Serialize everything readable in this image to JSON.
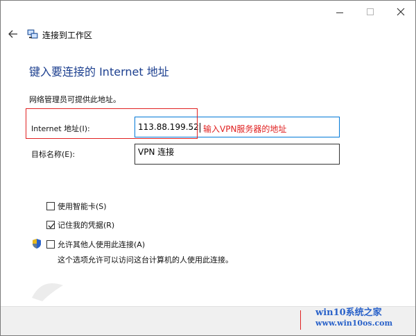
{
  "window": {
    "title": "连接到工作区",
    "caption_buttons": [
      "minimize",
      "maximize",
      "close"
    ]
  },
  "page": {
    "heading": "键入要连接的 Internet 地址",
    "subtitle": "网络管理员可提供此地址。"
  },
  "form": {
    "address_label": "Internet 地址(I):",
    "address_value": "113.88.199.52",
    "destination_label": "目标名称(E):",
    "destination_value": "VPN 连接"
  },
  "annotation": {
    "text": "输入VPN服务器的地址",
    "color": "#e02020"
  },
  "options": {
    "smart_card": {
      "label": "使用智能卡(S)",
      "checked": false
    },
    "remember_credentials": {
      "label": "记住我的凭据(R)",
      "checked": true
    },
    "allow_others": {
      "label": "允许其他人使用此连接(A)",
      "checked": false
    },
    "allow_others_desc": "这个选项允许可以访问这台计算机的人使用此连接。"
  },
  "watermark": {
    "title": "win10系统之家",
    "url": "www.win10os.com"
  },
  "colors": {
    "heading": "#1c3f8f",
    "input_focus_border": "#0078d7",
    "watermark": "#2a62c9"
  },
  "icons": {
    "back": "back-arrow-icon",
    "title": "network-connection-icon",
    "shield": "uac-shield-icon"
  }
}
